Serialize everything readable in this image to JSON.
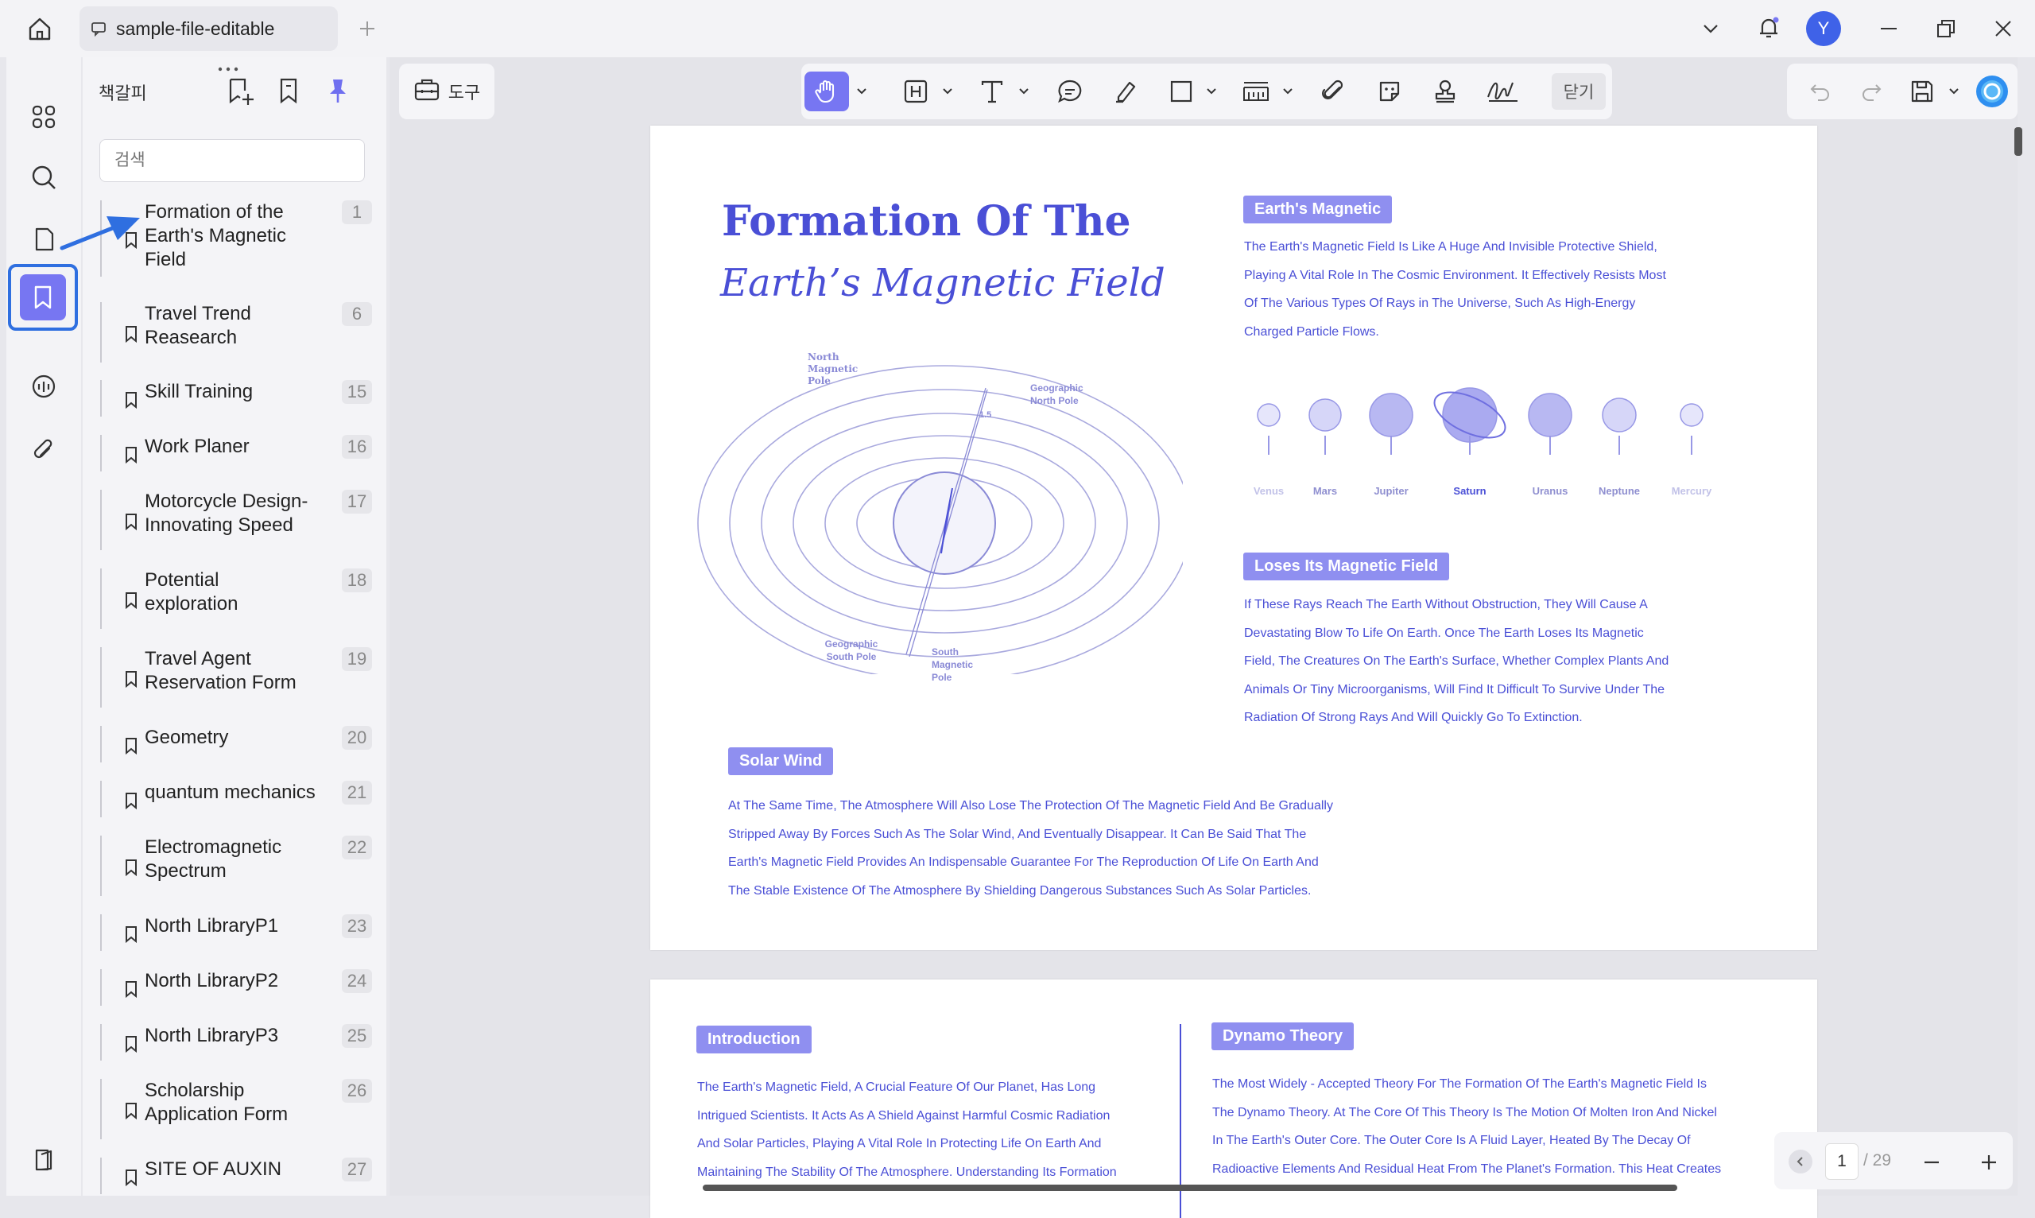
{
  "window": {
    "tab_title": "sample-file-editable",
    "avatar_letter": "Y"
  },
  "panel": {
    "title": "책갈피",
    "search_placeholder": "검색",
    "bookmarks": [
      {
        "label": "Formation of the Earth's Magnetic Field",
        "page": "1"
      },
      {
        "label": "Travel Trend Reasearch",
        "page": "6"
      },
      {
        "label": "Skill Training",
        "page": "15"
      },
      {
        "label": "Work Planer",
        "page": "16"
      },
      {
        "label": "Motorcycle Design-Innovating Speed",
        "page": "17"
      },
      {
        "label": "Potential exploration",
        "page": "18"
      },
      {
        "label": "Travel Agent Reservation Form",
        "page": "19"
      },
      {
        "label": "Geometry",
        "page": "20"
      },
      {
        "label": "quantum mechanics",
        "page": "21"
      },
      {
        "label": "Electromagnetic Spectrum",
        "page": "22"
      },
      {
        "label": "North LibraryP1",
        "page": "23"
      },
      {
        "label": "North LibraryP2",
        "page": "24"
      },
      {
        "label": "North LibraryP3",
        "page": "25"
      },
      {
        "label": "Scholarship Application Form",
        "page": "26"
      },
      {
        "label": "SITE OF AUXIN",
        "page": "27"
      }
    ]
  },
  "toolbar": {
    "tools_label": "도구",
    "close_label": "닫기"
  },
  "page1": {
    "title_line1": "Formation Of The",
    "title_line2": "Earth’s Magnetic Field",
    "diagram_labels": {
      "north_magnetic_pole": "North Magnetic Pole",
      "geographic_north_pole": "Geographic North Pole",
      "angle": "1.5",
      "geographic_south_pole": "Geographic South Pole",
      "south_magnetic_pole": "South Magnetic Pole"
    },
    "earths_magnetic": {
      "tag": "Earth's Magnetic",
      "lines": [
        "The Earth's Magnetic Field Is Like A Huge And Invisible Protective Shield,",
        "Playing A Vital Role In The Cosmic Environment. It Effectively Resists Most",
        "Of The Various Types Of Rays in The Universe, Such As High-Energy",
        "Charged Particle Flows."
      ]
    },
    "planets": [
      "Venus",
      "Mars",
      "Jupiter",
      "Saturn",
      "Uranus",
      "Neptune",
      "Mercury"
    ],
    "loses_field": {
      "tag": "Loses Its Magnetic Field",
      "lines": [
        "If These Rays Reach The Earth Without Obstruction, They Will Cause A",
        "Devastating Blow To Life On Earth. Once The Earth Loses Its Magnetic",
        "Field, The Creatures On The Earth's Surface, Whether Complex Plants And",
        "Animals Or Tiny Microorganisms, Will Find It Difficult To Survive Under The",
        "Radiation Of Strong Rays And Will Quickly Go To Extinction."
      ]
    },
    "solar_wind": {
      "tag": "Solar Wind",
      "lines": [
        "At The Same Time, The Atmosphere Will Also Lose The Protection Of The Magnetic Field And Be Gradually",
        "Stripped Away By Forces Such As The Solar Wind, And Eventually Disappear. It Can Be Said That The",
        "Earth's Magnetic Field Provides An Indispensable Guarantee For The Reproduction Of Life On Earth And",
        "The Stable Existence Of The Atmosphere By Shielding Dangerous Substances Such As Solar Particles."
      ]
    }
  },
  "page2": {
    "introduction": {
      "tag": "Introduction",
      "lines": [
        "The Earth's Magnetic Field, A Crucial Feature Of Our Planet, Has Long",
        "Intrigued Scientists. It Acts As A Shield Against Harmful Cosmic Radiation",
        "And Solar Particles, Playing A Vital Role In Protecting Life On Earth And",
        "Maintaining The Stability Of The Atmosphere. Understanding Its Formation"
      ]
    },
    "dynamo": {
      "tag": "Dynamo Theory",
      "lines": [
        "The Most Widely - Accepted Theory For The Formation Of The Earth's Magnetic Field Is",
        "The Dynamo Theory. At The Core Of This Theory Is The Motion Of Molten Iron And Nickel",
        "In The Earth's Outer Core. The Outer Core Is A Fluid Layer, Heated By The Decay Of",
        "Radioactive Elements And Residual Heat From The Planet's Formation. This Heat Creates"
      ]
    }
  },
  "pagenav": {
    "current_page": "1",
    "total_pages": "/ 29"
  },
  "colors": {
    "accent": "#7776f2",
    "doc_text": "#4a4fd6",
    "tag_bg": "#8f8ff0"
  }
}
